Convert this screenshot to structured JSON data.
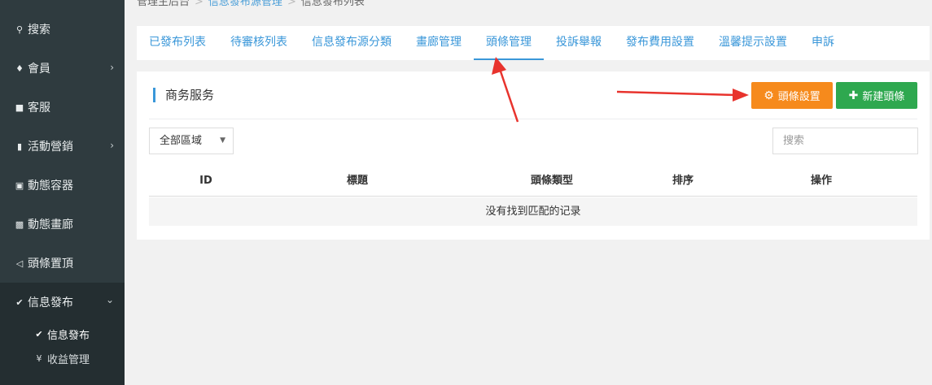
{
  "breadcrumb": {
    "root": "管理主后台",
    "middle": "信息發布源管理",
    "current": "信息發布列表"
  },
  "sidebar": {
    "items": [
      {
        "icon": "search-icon",
        "glyph": "🔍",
        "label": "搜索",
        "has_chevron": false
      },
      {
        "icon": "bell-icon",
        "glyph": "🔔",
        "label": "會員",
        "has_chevron": true
      },
      {
        "icon": "chat-icon",
        "glyph": "💬",
        "label": "客服",
        "has_chevron": false
      },
      {
        "icon": "bookmark-icon",
        "glyph": "🔖",
        "label": "活動營銷",
        "has_chevron": true
      },
      {
        "icon": "inbox-icon",
        "glyph": "📥",
        "label": "動態容器",
        "has_chevron": false
      },
      {
        "icon": "image-icon",
        "glyph": "🖼",
        "label": "動態畫廊",
        "has_chevron": false
      },
      {
        "icon": "volume-icon",
        "glyph": "🔊",
        "label": "頭條置頂",
        "has_chevron": false
      },
      {
        "icon": "check-edit-icon",
        "glyph": "✔",
        "label": "信息發布",
        "has_chevron": true
      }
    ],
    "sub_items": [
      {
        "icon": "check-edit-icon",
        "glyph": "✔",
        "label": "信息發布"
      },
      {
        "icon": "yen-icon",
        "glyph": "¥",
        "label": "收益管理"
      }
    ],
    "chevron_right": "›",
    "chevron_down": "⌄"
  },
  "tabs": [
    {
      "label": "已發布列表"
    },
    {
      "label": "待審核列表"
    },
    {
      "label": "信息發布源分類"
    },
    {
      "label": "畫廊管理"
    },
    {
      "label": "頭條管理"
    },
    {
      "label": "投訴舉報"
    },
    {
      "label": "發布費用設置"
    },
    {
      "label": "溫馨提示設置"
    },
    {
      "label": "申訴"
    }
  ],
  "active_tab": "頭條管理",
  "panel": {
    "title": "商务服务",
    "settings_button": "頭條設置",
    "settings_icon": "gear-icon",
    "new_button": "新建頭條",
    "new_icon": "plus-icon",
    "region_select": "全部區域",
    "search_placeholder": "搜索"
  },
  "table": {
    "columns": [
      "ID",
      "標題",
      "頭條類型",
      "排序",
      "操作"
    ],
    "empty_message": "没有找到匹配的记录"
  },
  "colors": {
    "sidebar_bg": "#2f3b3f",
    "accent_blue": "#3a97d9",
    "orange_button": "#f68a1c",
    "green_button": "#2ea84f",
    "annotation_red": "#e8332d"
  }
}
